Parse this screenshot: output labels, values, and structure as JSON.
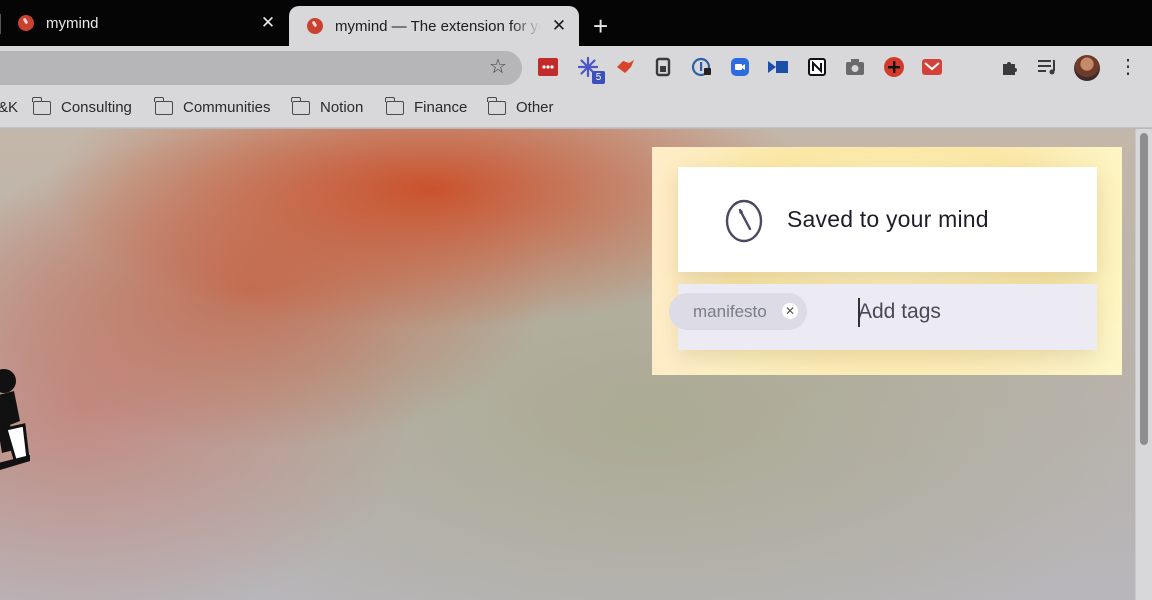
{
  "tabs": [
    {
      "title": "mymind",
      "active": false
    },
    {
      "title": "mymind — The extension for your mind",
      "active": true
    }
  ],
  "toolbar": {
    "extensions": [
      {
        "name": "lastpass-icon",
        "color": "#c22b2b"
      },
      {
        "name": "sparkle-extension-icon",
        "color": "#4a56c9",
        "badge": "5"
      },
      {
        "name": "bird-extension-icon",
        "color": "#d6442a"
      },
      {
        "name": "readability-icon",
        "color": "#3a3a3a"
      },
      {
        "name": "onepassword-icon",
        "color": "#2f5ea8"
      },
      {
        "name": "zoom-icon",
        "color": "#2d6be0"
      },
      {
        "name": "video-extension-icon",
        "color": "#1b4fa8"
      },
      {
        "name": "notion-icon",
        "color": "#111111"
      },
      {
        "name": "camera-icon",
        "color": "#5a5a5a"
      },
      {
        "name": "add-red-icon",
        "color": "#d33a2a"
      },
      {
        "name": "mail-icon",
        "color": "#d4403a"
      }
    ]
  },
  "bookmarks": {
    "cut_label": "&K",
    "items": [
      {
        "label": "Consulting"
      },
      {
        "label": "Communities"
      },
      {
        "label": "Notion"
      },
      {
        "label": "Finance"
      },
      {
        "label": "Other"
      }
    ]
  },
  "popup": {
    "saved_text": "Saved to your mind",
    "tags": [
      {
        "label": "manifesto"
      }
    ],
    "tag_input_placeholder": "Add tags"
  }
}
